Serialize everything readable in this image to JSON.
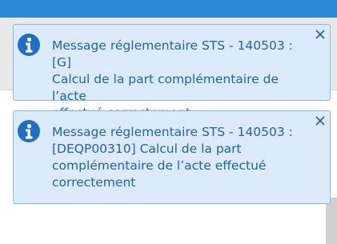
{
  "notifications": [
    {
      "icon": "info-icon",
      "message": "Message réglementaire STS - 140503 : [G]\nCalcul de la part complémentaire de l’acte\neffectué correctement"
    },
    {
      "icon": "info-icon",
      "message": "Message réglementaire STS - 140503 :\n[DEQP00310] Calcul de la part\ncomplémentaire de l’acte effectué\ncorrectement"
    }
  ],
  "colors": {
    "topbar": "#2b87d8",
    "toast_background": "#dcebfb",
    "toast_border": "#8ab7e6",
    "text": "#1f63b0",
    "icon": "#1f6fc2"
  }
}
